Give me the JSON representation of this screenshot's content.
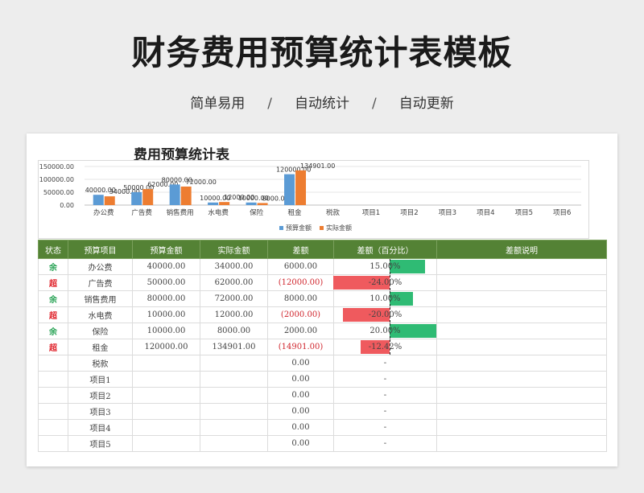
{
  "header": {
    "title": "财务费用预算统计表模板",
    "subtitle_items": [
      "简单易用",
      "自动统计",
      "自动更新"
    ],
    "separator": "/"
  },
  "sheet": {
    "title": "费用预算统计表"
  },
  "chart_data": {
    "type": "bar",
    "categories": [
      "办公费",
      "广告费",
      "销售费用",
      "水电费",
      "保险",
      "租金",
      "税款",
      "项目1",
      "项目2",
      "项目3",
      "项目4",
      "项目5",
      "项目6"
    ],
    "series": [
      {
        "name": "预算金额",
        "color": "#5b9bd5",
        "values": [
          40000,
          50000,
          80000,
          10000,
          10000,
          120000,
          0,
          0,
          0,
          0,
          0,
          0,
          0
        ]
      },
      {
        "name": "实际金额",
        "color": "#ed7d31",
        "values": [
          34000,
          62000,
          72000,
          12000,
          8000,
          134901,
          0,
          0,
          0,
          0,
          0,
          0,
          0
        ]
      }
    ],
    "data_labels": {
      "预算金额": [
        "40000.00",
        "50000.00",
        "80000.00",
        "10000.00",
        "10000.00",
        "120000.00"
      ],
      "实际金额": [
        "34000.00",
        "62000.00",
        "72000.00",
        "12000.00",
        "8000.00",
        "134901.00"
      ]
    },
    "y_ticks": [
      "150000.00",
      "100000.00",
      "50000.00",
      "0.00"
    ],
    "y_tick_values": [
      150000,
      100000,
      50000,
      0
    ],
    "ylim": [
      0,
      150000
    ],
    "legend_position": "bottom-left",
    "grid": true
  },
  "table": {
    "columns": [
      "状态",
      "预算项目",
      "预算金额",
      "实际金额",
      "差额",
      "差额（百分比）",
      "差额说明"
    ],
    "rows": [
      {
        "status": "余",
        "status_type": "surplus",
        "item": "办公费",
        "budget": "40000.00",
        "actual": "34000.00",
        "diff": "6000.00",
        "diff_neg": false,
        "pct": "15.00%",
        "pct_value": 15
      },
      {
        "status": "超",
        "status_type": "over",
        "item": "广告费",
        "budget": "50000.00",
        "actual": "62000.00",
        "diff": "(12000.00)",
        "diff_neg": true,
        "pct": "-24.00%",
        "pct_value": -24
      },
      {
        "status": "余",
        "status_type": "surplus",
        "item": "销售费用",
        "budget": "80000.00",
        "actual": "72000.00",
        "diff": "8000.00",
        "diff_neg": false,
        "pct": "10.00%",
        "pct_value": 10
      },
      {
        "status": "超",
        "status_type": "over",
        "item": "水电费",
        "budget": "10000.00",
        "actual": "12000.00",
        "diff": "(2000.00)",
        "diff_neg": true,
        "pct": "-20.00%",
        "pct_value": -20
      },
      {
        "status": "余",
        "status_type": "surplus",
        "item": "保险",
        "budget": "10000.00",
        "actual": "8000.00",
        "diff": "2000.00",
        "diff_neg": false,
        "pct": "20.00%",
        "pct_value": 20
      },
      {
        "status": "超",
        "status_type": "over",
        "item": "租金",
        "budget": "120000.00",
        "actual": "134901.00",
        "diff": "(14901.00)",
        "diff_neg": true,
        "pct": "-12.42%",
        "pct_value": -12.42
      },
      {
        "status": "",
        "status_type": "",
        "item": "税款",
        "budget": "",
        "actual": "",
        "diff": "0.00",
        "diff_neg": false,
        "pct": "-",
        "pct_value": 0
      },
      {
        "status": "",
        "status_type": "",
        "item": "项目1",
        "budget": "",
        "actual": "",
        "diff": "0.00",
        "diff_neg": false,
        "pct": "-",
        "pct_value": 0
      },
      {
        "status": "",
        "status_type": "",
        "item": "项目2",
        "budget": "",
        "actual": "",
        "diff": "0.00",
        "diff_neg": false,
        "pct": "-",
        "pct_value": 0
      },
      {
        "status": "",
        "status_type": "",
        "item": "项目3",
        "budget": "",
        "actual": "",
        "diff": "0.00",
        "diff_neg": false,
        "pct": "-",
        "pct_value": 0
      },
      {
        "status": "",
        "status_type": "",
        "item": "项目4",
        "budget": "",
        "actual": "",
        "diff": "0.00",
        "diff_neg": false,
        "pct": "-",
        "pct_value": 0
      },
      {
        "status": "",
        "status_type": "",
        "item": "项目5",
        "budget": "",
        "actual": "",
        "diff": "0.00",
        "diff_neg": false,
        "pct": "-",
        "pct_value": 0
      }
    ]
  }
}
